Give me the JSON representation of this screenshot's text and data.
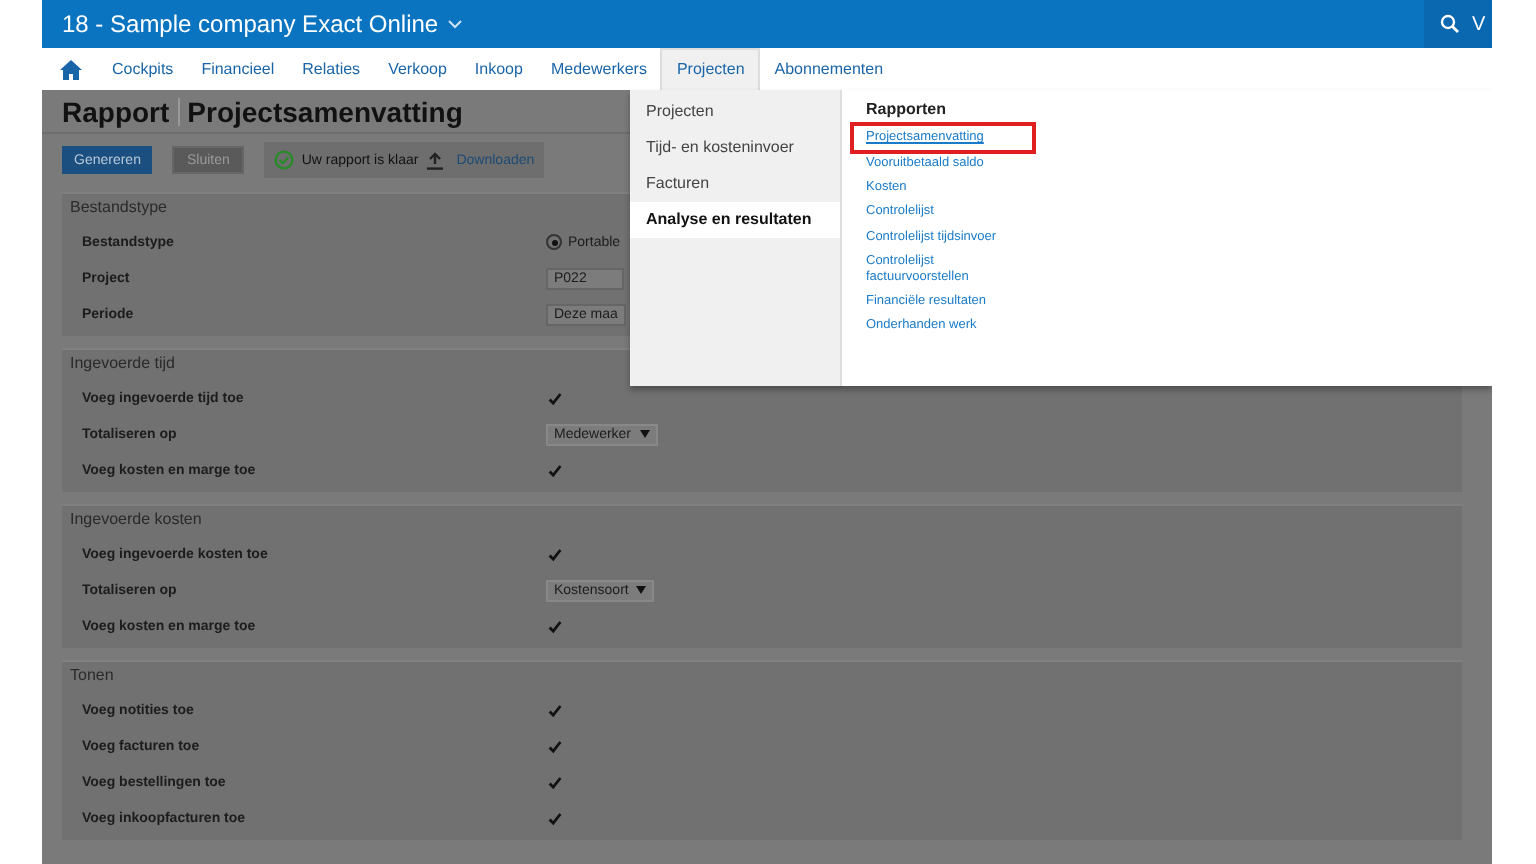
{
  "top_bar": {
    "title": "18 - Sample company Exact Online",
    "search_label": "V"
  },
  "nav": {
    "items": [
      {
        "label": "Cockpits",
        "selected": false
      },
      {
        "label": "Financieel",
        "selected": false
      },
      {
        "label": "Relaties",
        "selected": false
      },
      {
        "label": "Verkoop",
        "selected": false
      },
      {
        "label": "Inkoop",
        "selected": false
      },
      {
        "label": "Medewerkers",
        "selected": false
      },
      {
        "label": "Projecten",
        "selected": true
      },
      {
        "label": "Abonnementen",
        "selected": false
      }
    ]
  },
  "page": {
    "title_prefix": "Rapport",
    "title": "Projectsamenvatting",
    "toolbar": {
      "buttons": [
        {
          "label": "Genereren",
          "kind": "primary"
        },
        {
          "label": "Sluiten",
          "kind": "secondary"
        }
      ],
      "status": "Uw rapport is klaar",
      "download": "Downloaden"
    },
    "sections": [
      {
        "title": "Bestandstype",
        "rows": [
          {
            "label": "Bestandstype",
            "kind": "radio",
            "value": "Portable",
            "checked": true
          },
          {
            "label": "Project",
            "kind": "input",
            "value": "P022"
          },
          {
            "label": "Periode",
            "kind": "input",
            "value": "Deze maa"
          }
        ]
      },
      {
        "title": "Ingevoerde tijd",
        "rows": [
          {
            "label": "Voeg ingevoerde tijd toe",
            "kind": "checkbox",
            "checked": true
          },
          {
            "label": "Totaliseren op",
            "kind": "select",
            "value": "Medewerker"
          },
          {
            "label": "Voeg kosten en marge toe",
            "kind": "checkbox",
            "checked": true
          }
        ]
      },
      {
        "title": "Ingevoerde kosten",
        "rows": [
          {
            "label": "Voeg ingevoerde kosten toe",
            "kind": "checkbox",
            "checked": true
          },
          {
            "label": "Totaliseren op",
            "kind": "select",
            "value": "Kostensoort"
          },
          {
            "label": "Voeg kosten en marge toe",
            "kind": "checkbox",
            "checked": true
          }
        ]
      },
      {
        "title": "Tonen",
        "rows": [
          {
            "label": "Voeg notities toe",
            "kind": "checkbox",
            "checked": true
          },
          {
            "label": "Voeg facturen toe",
            "kind": "checkbox",
            "checked": true
          },
          {
            "label": "Voeg bestellingen toe",
            "kind": "checkbox",
            "checked": true
          },
          {
            "label": "Voeg inkoopfacturen toe",
            "kind": "checkbox",
            "checked": true
          }
        ]
      }
    ]
  },
  "menu": {
    "categories": [
      {
        "label": "Projecten",
        "selected": false
      },
      {
        "label": "Tijd- en kosteninvoer",
        "selected": false
      },
      {
        "label": "Facturen",
        "selected": false
      },
      {
        "label": "Analyse en resultaten",
        "selected": true
      }
    ],
    "heading": "Rapporten",
    "links": [
      {
        "label": "Projectsamenvatting",
        "highlighted": true
      },
      {
        "label": "Vooruitbetaald saldo",
        "highlighted": false
      },
      {
        "label": "Kosten",
        "highlighted": false
      },
      {
        "label": "Controlelijst",
        "highlighted": false
      },
      {
        "label": "Controlelijst tijdsinvoer",
        "highlighted": false
      },
      {
        "label": "Controlelijst factuurvoorstellen",
        "highlighted": false
      },
      {
        "label": "Financiële resultaten",
        "highlighted": false
      },
      {
        "label": "Onderhanden werk",
        "highlighted": false
      }
    ]
  }
}
